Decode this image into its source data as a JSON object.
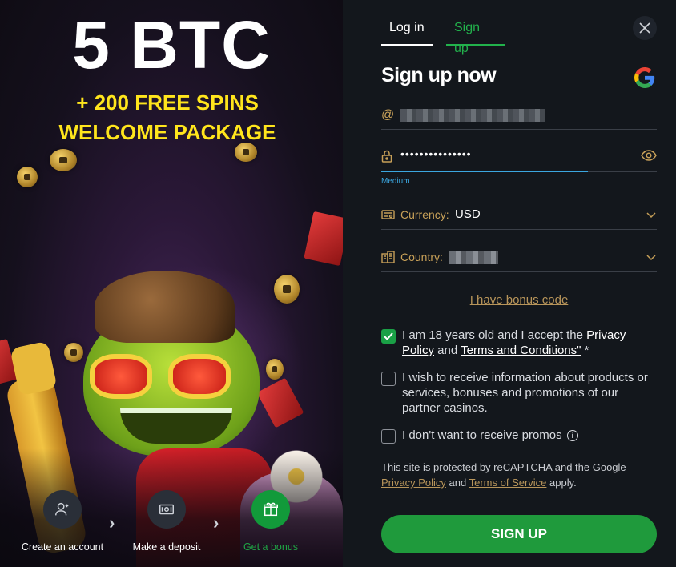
{
  "promo": {
    "headline": "5 BTC",
    "line1": "+ 200 FREE SPINS",
    "line2": "WELCOME PACKAGE",
    "steps": [
      {
        "label": "Create an account",
        "icon": "user-plus-icon"
      },
      {
        "label": "Make a deposit",
        "icon": "banknote-icon"
      },
      {
        "label": "Get a bonus",
        "icon": "gift-icon"
      }
    ],
    "step_arrow": "›"
  },
  "auth": {
    "tabs": [
      {
        "label": "Log in",
        "active": false
      },
      {
        "label": "Sign up",
        "active": true
      }
    ],
    "heading": "Sign up now",
    "email_icon": "@",
    "password_mask": "•••••••••••••••",
    "password_strength": "Medium",
    "currency_label": "Currency:",
    "currency_value": "USD",
    "country_label": "Country:",
    "bonus_link": "I have bonus code",
    "checks": {
      "age_prefix": "I am 18 years old and I accept the ",
      "privacy_policy": "Privacy Policy",
      "and": " and ",
      "terms": "Terms and Conditions\"",
      "age_suffix": " *",
      "age_checked": true,
      "info": "I wish to receive information about products or services, bonuses and promotions of our partner casinos.",
      "info_checked": false,
      "no_promos": "I don't want to receive promos",
      "no_promos_checked": false
    },
    "recaptcha": {
      "prefix": "This site is protected by reCAPTCHA and the Google ",
      "privacy": "Privacy Policy",
      "and": " and ",
      "terms": "Terms of Service",
      "suffix": " apply."
    },
    "submit": "SIGN UP"
  },
  "colors": {
    "accent_green": "#1f9a3c",
    "tab_green": "#22b24c",
    "headline_yellow": "#ffe51c",
    "gold_text": "#c7a058",
    "strength_blue": "#3ba7e0"
  }
}
